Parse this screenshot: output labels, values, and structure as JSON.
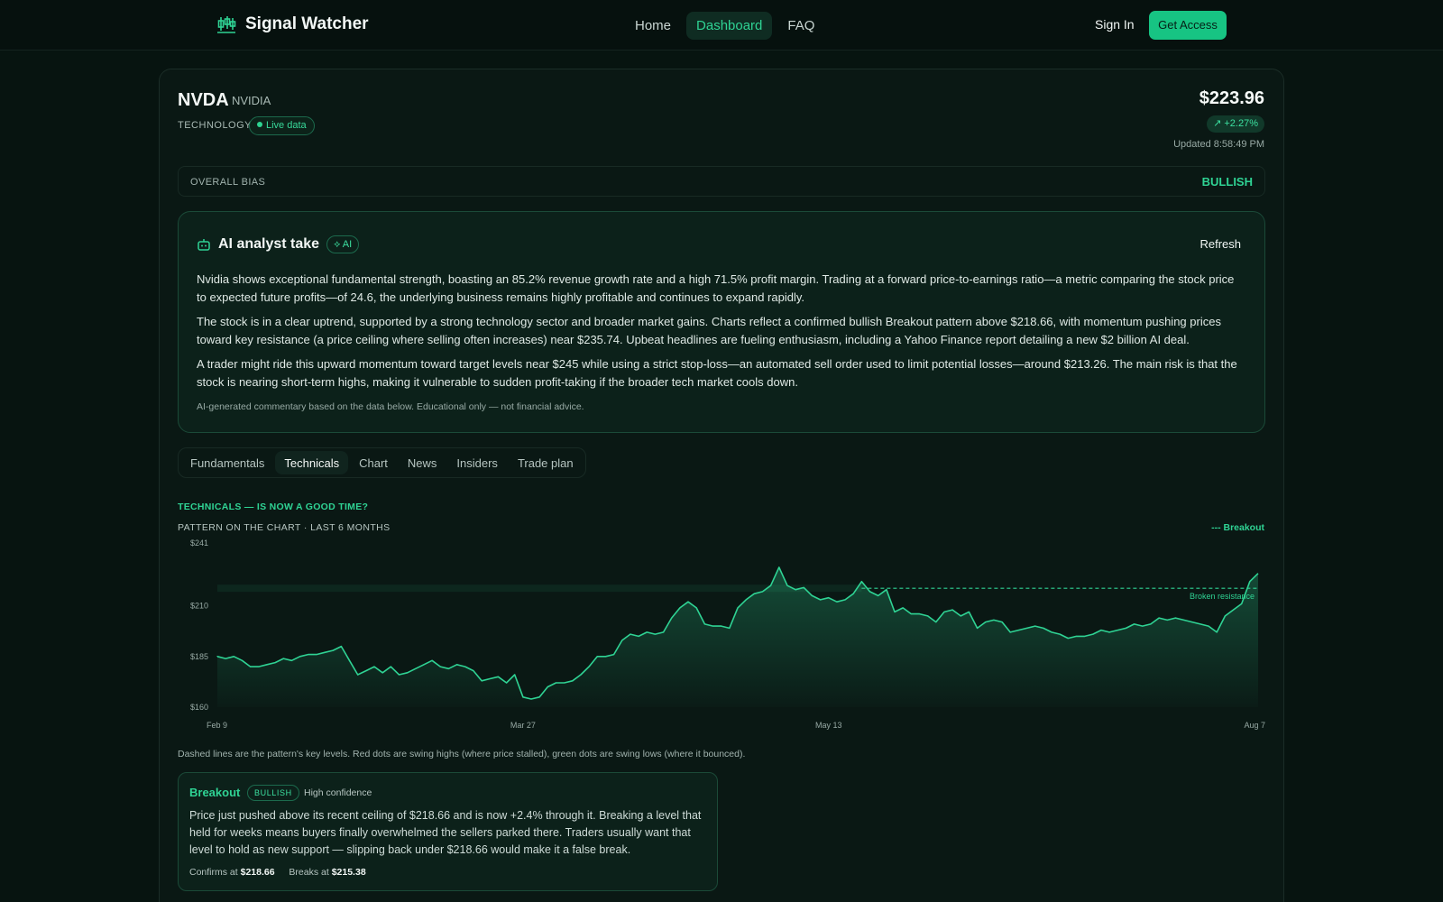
{
  "nav": {
    "brand": "Signal Watcher",
    "links": [
      "Home",
      "Dashboard",
      "FAQ"
    ],
    "active": "Dashboard",
    "sign_in": "Sign In",
    "cta": "Get Access"
  },
  "stock": {
    "ticker": "NVDA",
    "company": "NVIDIA",
    "sector": "TECHNOLOGY",
    "live": "Live data",
    "price": "$223.96",
    "change": "+2.27%",
    "updated": "Updated 8:58:49 PM"
  },
  "bias": {
    "label": "OVERALL BIAS",
    "value": "BULLISH"
  },
  "ai": {
    "title": "AI analyst take",
    "badge": "AI",
    "refresh": "Refresh",
    "paragraphs": [
      "Nvidia shows exceptional fundamental strength, boasting an 85.2% revenue growth rate and a high 71.5% profit margin. Trading at a forward price-to-earnings ratio—a metric comparing the stock price to expected future profits—of 24.6, the underlying business remains highly profitable and continues to expand rapidly.",
      "The stock is in a clear uptrend, supported by a strong technology sector and broader market gains. Charts reflect a confirmed bullish Breakout pattern above $218.66, with momentum pushing prices toward key resistance (a price ceiling where selling often increases) near $235.74. Upbeat headlines are fueling enthusiasm, including a Yahoo Finance report detailing a new $2 billion AI deal.",
      "A trader might ride this upward momentum toward target levels near $245 while using a strict stop-loss—an automated sell order used to limit potential losses—around $213.26. The main risk is that the stock is nearing short-term highs, making it vulnerable to sudden profit-taking if the broader tech market cools down."
    ],
    "note": "AI-generated commentary based on the data below. Educational only — not financial advice."
  },
  "tabs": [
    "Fundamentals",
    "Technicals",
    "Chart",
    "News",
    "Insiders",
    "Trade plan"
  ],
  "active_tab": "Technicals",
  "technicals": {
    "title": "TECHNICALS — IS NOW A GOOD TIME?",
    "subtitle": "PATTERN ON THE CHART · LAST 6 MONTHS",
    "legend": "--- Breakout",
    "caption": "Dashed lines are the pattern's key levels. Red dots are swing highs (where price stalled), green dots are swing lows (where it bounced)."
  },
  "chart_data": {
    "type": "area",
    "y_ticks": [
      "$241",
      "$210",
      "$185",
      "$160"
    ],
    "x_ticks": [
      "Feb 9",
      "Mar 27",
      "May 13",
      "Aug 7"
    ],
    "ylim": [
      160,
      241
    ],
    "annotation": "Broken resistance",
    "resistance": 218.66,
    "values": [
      185,
      184,
      185,
      183,
      180,
      180,
      181,
      182,
      184,
      183,
      185,
      186,
      186,
      187,
      188,
      190,
      183,
      176,
      178,
      180,
      177,
      180,
      176,
      177,
      179,
      181,
      183,
      180,
      179,
      181,
      180,
      178,
      173,
      174,
      175,
      172,
      176,
      165,
      164,
      165,
      170,
      172,
      172,
      173,
      176,
      180,
      185,
      185,
      186,
      193,
      196,
      195,
      197,
      196,
      197,
      204,
      209,
      212,
      209,
      201,
      200,
      200,
      199,
      209,
      213,
      216,
      217,
      220,
      229,
      220,
      218,
      219,
      215,
      213,
      214,
      212,
      213,
      216,
      222,
      217,
      215,
      218,
      207,
      209,
      206,
      206,
      205,
      202,
      207,
      208,
      205,
      207,
      199,
      202,
      203,
      202,
      197,
      198,
      199,
      200,
      199,
      197,
      196,
      194,
      195,
      195,
      196,
      198,
      197,
      198,
      199,
      201,
      200,
      201,
      204,
      203,
      204,
      203,
      202,
      201,
      200,
      197,
      205,
      208,
      211,
      222,
      226
    ]
  },
  "pattern": {
    "name": "Breakout",
    "badge": "BULLISH",
    "confidence": "High confidence",
    "description": "Price just pushed above its recent ceiling of $218.66 and is now +2.4% through it. Breaking a level that held for weeks means buyers finally overwhelmed the sellers parked there. Traders usually want that level to hold as new support — slipping back under $218.66 would make it a false break.",
    "confirms_label": "Confirms at",
    "confirms_value": "$218.66",
    "breaks_label": "Breaks at",
    "breaks_value": "$215.38"
  },
  "colors": {
    "accent": "#2fd394",
    "background": "#071410",
    "line": "#2fd394"
  }
}
